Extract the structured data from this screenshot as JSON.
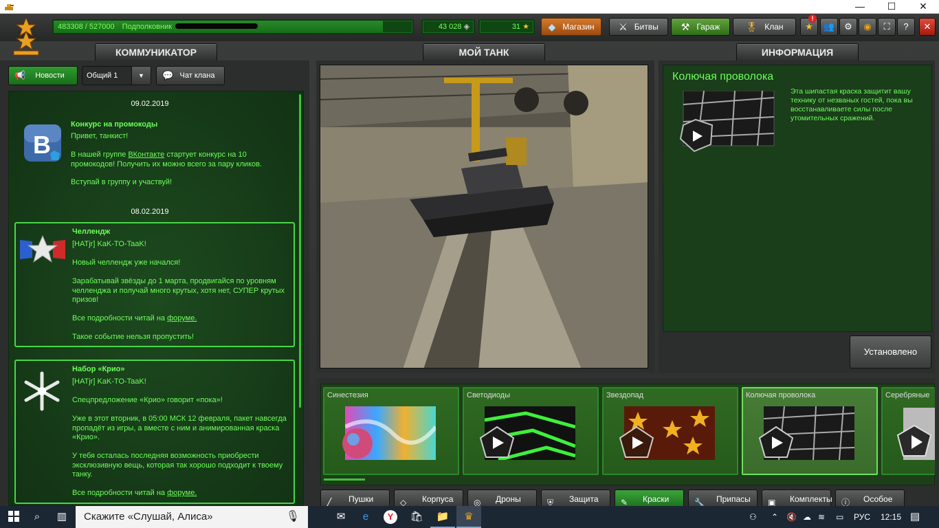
{
  "window": {
    "minimize": "—",
    "maximize": "☐",
    "close": "✕"
  },
  "hud": {
    "xp": "483308 / 527000",
    "rank_name": "Подполковник",
    "crystals": "43 028",
    "stars": "31",
    "shop": "Магазин",
    "battles": "Битвы",
    "garage": "Гараж",
    "clan": "Клан",
    "xp_progress": 0.917
  },
  "comm": {
    "tab": "КОММУНИКАТОР",
    "news": "Новости",
    "channel": "Общий 1",
    "clanchat": "Чат клана"
  },
  "feed": [
    {
      "date": "09.02.2019",
      "title": "Конкурс на промокоды",
      "lines": [
        "Привет, танкист!"
      ],
      "pre": "В нашей группе ",
      "link": "ВКонтакте",
      "post": " стартует конкурс на 10\nпромокодов! Получить их можно всего за пару кликов.",
      "tail": "Вступай в группу и участвуй!"
    },
    {
      "date": "08.02.2019",
      "title": "Челлендж",
      "author": "[HATjr] KaK-TO-TaaK!",
      "l1": "Новый челлендж уже начался!",
      "l2": "Зарабатывай звёзды до 1 марта, продвигайся по уровням\nчелленджа и получай много крутых, хотя нет, СУПЕР крутых\nпризов!",
      "pre": "Все подробности читай на ",
      "link": "форуме.",
      "tail": "Такое событие нельзя пропустить!"
    },
    {
      "title": "Набор «Крио»",
      "author": "[HATjr] KaK-TO-TaaK!",
      "l1": "Спецпредложение «Крио» говорит «пока»!",
      "l2": "Уже в этот вторник, в 05:00 МСК 12 февраля, пакет навсегда\nпропадёт из игры, а вместе с ним и анимированная краска\n«Крио».",
      "l3": "У тебя осталась последняя возможность приобрести\nэксклюзивную вещь, которая так хорошо подходит к твоему\nтанку.",
      "pre": "Все подробности читай на ",
      "link": "форуме."
    }
  ],
  "mytank": {
    "tab": "МОЙ ТАНК"
  },
  "info": {
    "tab": "ИНФОРМАЦИЯ",
    "title": "Колючая проволока",
    "desc": "Эта шипастая краска защитит вашу технику от незваных гостей, пока вы восстанавливаете силы после утомительных сражений.",
    "installed": "Установлено"
  },
  "paints": [
    "Синестезия",
    "Светодиоды",
    "Звездопад",
    "Колючая проволока",
    "Серебряные"
  ],
  "tabs": [
    "Пушки",
    "Корпуса",
    "Дроны",
    "Защита",
    "Краски",
    "Припасы",
    "Комплекты",
    "Особое"
  ],
  "taskbar": {
    "search": "Скажите «Слушай, Алиса»",
    "lang": "РУС",
    "time": "12:15"
  },
  "colors": {
    "accent": "#6dff5a",
    "panel": "#2c2e2d",
    "feed_bg": "#1b451d"
  }
}
